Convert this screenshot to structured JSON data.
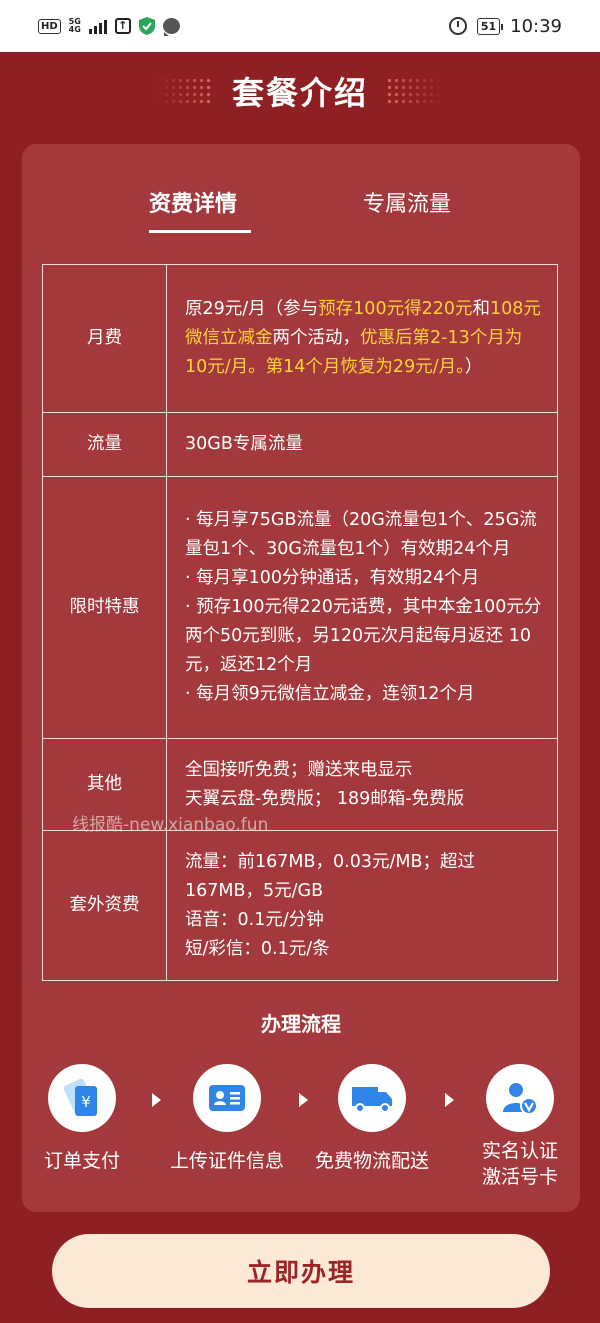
{
  "status_bar": {
    "hd": "HD",
    "network": "5G",
    "network_sub": "4G",
    "battery": "51",
    "time": "10:39"
  },
  "header": {
    "title": "套餐介绍"
  },
  "tabs": [
    {
      "label": "资费详情",
      "active": true
    },
    {
      "label": "专属流量",
      "active": false
    }
  ],
  "table": {
    "monthly_fee": {
      "key": "月费",
      "p1": "原29元/月（参与",
      "h1": "预存100元得220元",
      "p2": "和",
      "h2": "108元微信立减金",
      "p3": "两个活动，",
      "h3": "优惠后第2-13个月为10元/月。第14个月恢复为29元/月。",
      "p4": "）"
    },
    "data": {
      "key": "流量",
      "value": "30GB专属流量"
    },
    "promo": {
      "key": "限时特惠",
      "lines": [
        "· 每月享75GB流量（20G流量包1个、25G流量包1个、30G流量包1个）有效期24个月",
        "· 每月享100分钟通话，有效期24个月",
        "· 预存100元得220元话费，其中本金100元分两个50元到账，另120元次月起每月返还 10元，返还12个月",
        "· 每月领9元微信立减金，连领12个月"
      ]
    },
    "other": {
      "key": "其他",
      "lines": [
        "全国接听免费；赠送来电显示",
        "天翼云盘-免费版； 189邮箱-免费版"
      ]
    },
    "extra_fee": {
      "key": "套外资费",
      "lines": [
        "流量：前167MB，0.03元/MB；超过167MB，5元/GB",
        "语音：0.1元/分钟",
        "短/彩信：0.1元/条"
      ]
    }
  },
  "watermark": "线报酷-new.xianbao.fun",
  "process": {
    "title": "办理流程",
    "steps": [
      {
        "label": "订单支付",
        "icon": "payment-icon"
      },
      {
        "label": "上传证件信息",
        "icon": "id-card-icon"
      },
      {
        "label": "免费物流配送",
        "icon": "truck-icon"
      },
      {
        "label": "实名认证激活号卡",
        "label_line1": "实名认证",
        "label_line2": "激活号卡",
        "icon": "user-verified-icon"
      }
    ]
  },
  "cta": {
    "label": "立即办理"
  },
  "colors": {
    "background": "#8e1f22",
    "card": "#a3393c",
    "highlight": "#ffd33a",
    "icon_blue": "#2f86e8",
    "cta_bg": "#fbe8d5",
    "cta_text": "#9a2426"
  }
}
